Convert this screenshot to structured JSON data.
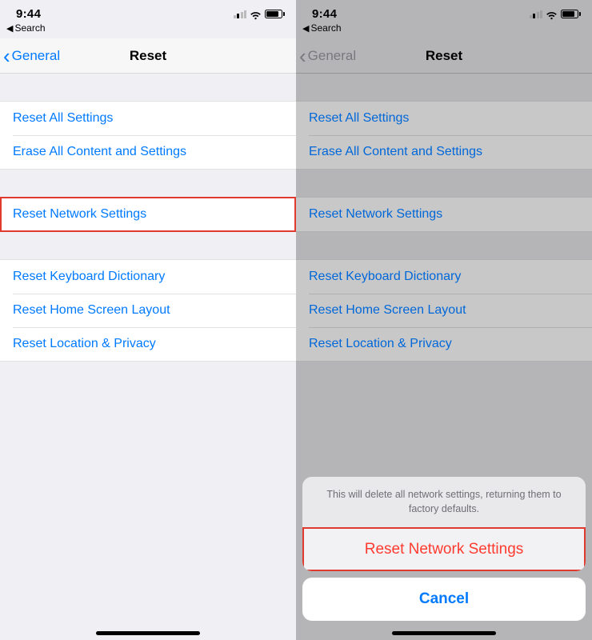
{
  "status": {
    "time": "9:44"
  },
  "back_search": "Search",
  "nav": {
    "back": "General",
    "title": "Reset"
  },
  "groups": [
    [
      {
        "label": "Reset All Settings"
      },
      {
        "label": "Erase All Content and Settings"
      }
    ],
    [
      {
        "label": "Reset Network Settings"
      }
    ],
    [
      {
        "label": "Reset Keyboard Dictionary"
      },
      {
        "label": "Reset Home Screen Layout"
      },
      {
        "label": "Reset Location & Privacy"
      }
    ]
  ],
  "sheet": {
    "message": "This will delete all network settings, returning them to factory defaults.",
    "action": "Reset Network Settings",
    "cancel": "Cancel"
  }
}
